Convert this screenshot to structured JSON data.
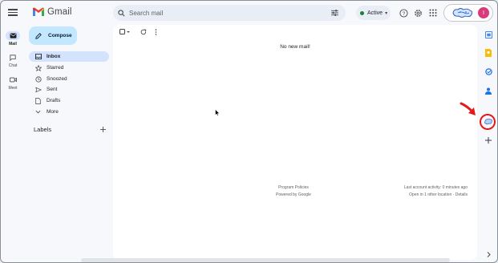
{
  "app": {
    "name": "Gmail"
  },
  "search": {
    "placeholder": "Search mail"
  },
  "status": {
    "label": "Active"
  },
  "account": {
    "avatar_initial": "I"
  },
  "rail": {
    "items": [
      {
        "label": "Mail",
        "icon": "mail-icon",
        "active": true
      },
      {
        "label": "Chat",
        "icon": "chat-icon",
        "active": false
      },
      {
        "label": "Meet",
        "icon": "video-icon",
        "active": false
      }
    ]
  },
  "compose": {
    "label": "Compose"
  },
  "nav": {
    "items": [
      {
        "label": "Inbox",
        "icon": "inbox-icon",
        "active": true
      },
      {
        "label": "Starred",
        "icon": "star-icon"
      },
      {
        "label": "Snoozed",
        "icon": "clock-icon"
      },
      {
        "label": "Sent",
        "icon": "send-icon"
      },
      {
        "label": "Drafts",
        "icon": "draft-icon"
      },
      {
        "label": "More",
        "icon": "chevron-down-icon"
      }
    ]
  },
  "labels": {
    "title": "Labels"
  },
  "main": {
    "empty_message": "No new mail!",
    "footer": {
      "program_policies": "Program Policies",
      "powered_by": "Powered by Google",
      "last_activity": "Last account activity: 0 minutes ago",
      "other_location": "Open in 1 other location",
      "separator": " · ",
      "details": "Details"
    }
  },
  "side_panel": {
    "icons": [
      "calendar-icon",
      "keep-icon",
      "tasks-icon",
      "contacts-icon",
      "addon-icon",
      "add-icon",
      "chevron-right-icon"
    ]
  },
  "colors": {
    "background": "#f6f8fc",
    "compose": "#c2e7ff",
    "selected": "#d3e3fd",
    "status_dot": "#188038",
    "annotation": "#e01b1b",
    "avatar": "#d93a79"
  }
}
